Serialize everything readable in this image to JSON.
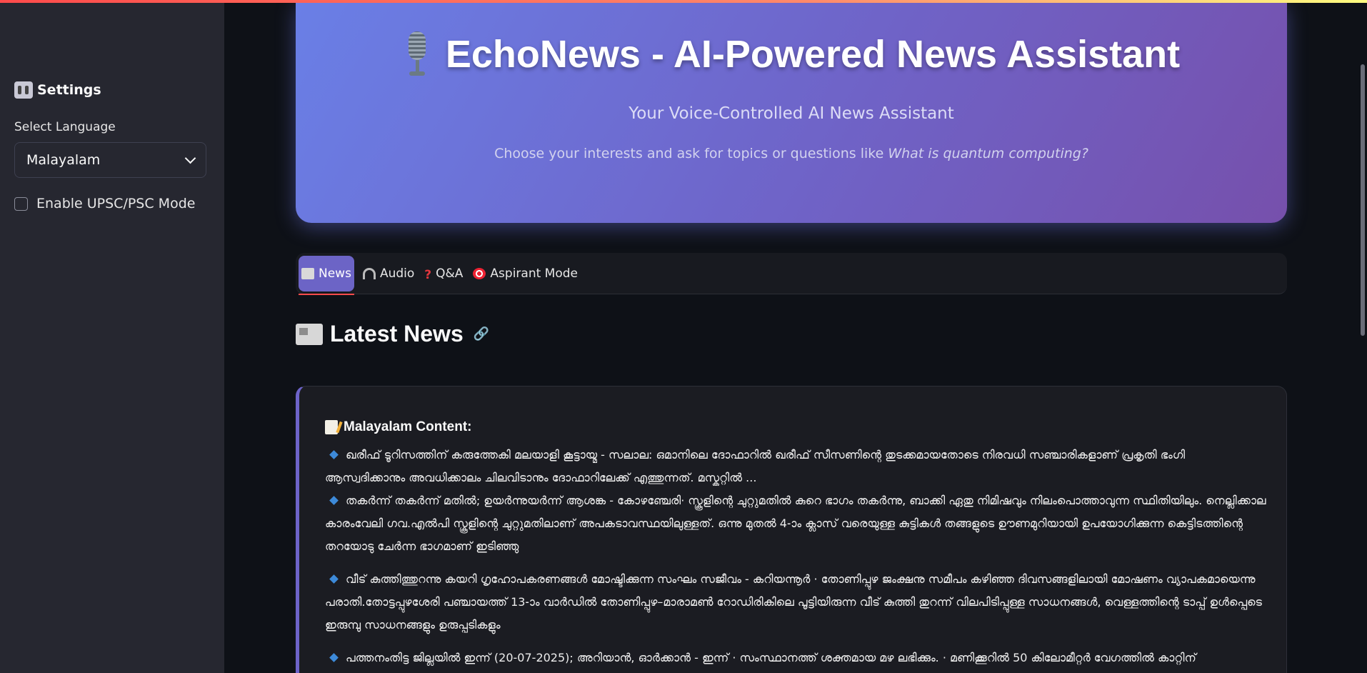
{
  "sidebar": {
    "title": "Settings",
    "title_icon": "control-knobs-icon",
    "language_label": "Select Language",
    "language_selected": "Malayalam",
    "checkbox_label": "Enable UPSC/PSC Mode",
    "checkbox_checked": false
  },
  "hero": {
    "title": "EchoNews - AI-Powered News Assistant",
    "title_icon": "microphone-icon",
    "subtitle": "Your Voice-Controlled AI News Assistant",
    "description_prefix": "Choose your interests and ask for topics or questions like ",
    "description_example": "What is quantum computing?"
  },
  "tabs": [
    {
      "label": "News",
      "icon": "newspaper-icon",
      "active": true
    },
    {
      "label": "Audio",
      "icon": "headphones-icon",
      "active": false
    },
    {
      "label": "Q&A",
      "icon": "question-icon",
      "active": false
    },
    {
      "label": "Aspirant Mode",
      "icon": "target-icon",
      "active": false
    }
  ],
  "section": {
    "title": "Latest News",
    "icon": "newspaper-icon"
  },
  "card": {
    "heading": "Malayalam Content:",
    "items": [
      "ഖരീഫ് ടൂറിസത്തിന് കരുത്തേകി മലയാളി കൂട്ടായ്മ - സലാല: ഒമാനിലെ ദോഫാറിൽ ഖരീഫ് സീസണിന്റെ തുടക്കമായതോടെ നിരവധി സഞ്ചാരികളാണ് പ്രകൃതി ഭംഗി ആസ്വദിക്കാനും അവധിക്കാലം ചിലവിടാനും ദോഫാറിലേക്ക് എത്തുന്നത്. മസ്കറ്റിൽ ...",
      "തകർന്ന് തകർന്ന് മതിൽ; ഉയർന്നുയർന്ന് ആശങ്ക - കോഴഞ്ചേരി· സ്കൂളിന്റെ ചുറ്റുമതിൽ കുറെ ഭാഗം തകർന്നു, ബാക്കി ഏതു നിമിഷവും നിലംപൊത്താവുന്ന സ്ഥിതിയിലും. നെല്ലിക്കാല കാരംവേലി ഗവ.എൽപി സ്കൂളിന്റെ ചുറ്റുമതിലാണ് അപകടാവസ്ഥയിലുള്ളത്. ഒന്നു മുതൽ 4-ാം ക്ലാസ് വരെയുള്ള കുട്ടികൾ തങ്ങളുടെ ഊണമുറിയായി ഉപയോഗിക്കുന്ന കെട്ടിടത്തിന്റെ തറയോടു ചേർന്ന ഭാഗമാണ് ഇടിഞ്ഞു",
      "വീട് കുത്തിത്തുറന്നു കയറി ഗൃഹോപകരണങ്ങൾ മോഷ്ടിക്കുന്ന സംഘം സജീവം - കറിയന്നൂർ · തോണിപ്പുഴ ജംക്ഷനു സമീപം കഴിഞ്ഞ ദിവസങ്ങളിലായി മോഷണം വ്യാപകമായെന്നു പരാതി.തോട്ടപ്പുഴശേരി പഞ്ചായത്ത് 13-ാം വാർഡിൽ തോണിപ്പുഴ–മാരാമൺ റോഡിരികിലെ പൂട്ടിയിരുന്ന വീട് കുത്തി തുറന്ന് വിലപിടിപ്പുള്ള സാധനങ്ങൾ, വെള്ളത്തിന്റെ ടാപ്പ് ഉൾപ്പെടെ ഇരുമ്പു സാധനങ്ങളും ഉരുപ്പടികളും",
      "പത്തനംതിട്ട ജില്ലയിൽ ഇന്ന് (20-07-2025); അറിയാൻ, ഓർക്കാൻ - ഇന്ന് · സംസ്ഥാനത്ത് ശക്തമായ മഴ ലഭിക്കും. · മണിക്കൂറിൽ 50 കിലോമീറ്റർ വേഗത്തിൽ കാറ്റിന്"
    ]
  },
  "colors": {
    "accent": "#ff4b4b",
    "hero_gradient_start": "#6a7fe6",
    "hero_gradient_end": "#7650ac",
    "active_tab": "#6c64c6",
    "bullet": "#3d8ad9"
  }
}
